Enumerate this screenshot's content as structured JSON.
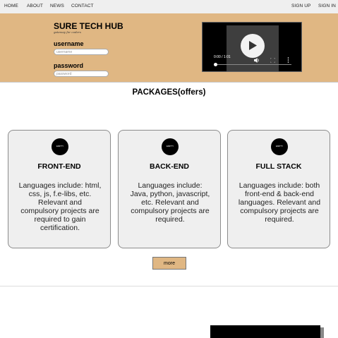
{
  "nav": {
    "home": "HOME",
    "about": "ABOUT",
    "news": "NEWS",
    "contact": "CONTACT",
    "sign_up": "SIGN UP",
    "sign_in": "SIGN IN"
  },
  "brand": {
    "title": "SURE TECH HUB",
    "tagline": "gateway for coders"
  },
  "login": {
    "username_label": "username",
    "username_placeholder": "username",
    "password_label": "password",
    "password_placeholder": "password"
  },
  "video": {
    "time": "0:00 / 1:01",
    "progress": 0
  },
  "packages": {
    "title": "PACKAGES(offers)",
    "cards": [
      {
        "icon_text": "EMPTY",
        "title": "FRONT-END",
        "text": "Languages include: html, css, js, f.e-libs, etc. Relevant and compulsory projects are required to gain certification."
      },
      {
        "icon_text": "EMPTY",
        "title": "BACK-END",
        "text": "Languages include: Java, python, javascript, etc. Relevant and compulsory projects are required."
      },
      {
        "icon_text": "EMPTY",
        "title": "FULL STACK",
        "text": "Languages include: both front-end & back-end languages. Relevant and compulsory projects are required."
      }
    ],
    "more_label": "more"
  },
  "colors": {
    "accent": "#e0b783",
    "card_bg": "#efefef",
    "nav_bg": "#efefef"
  }
}
